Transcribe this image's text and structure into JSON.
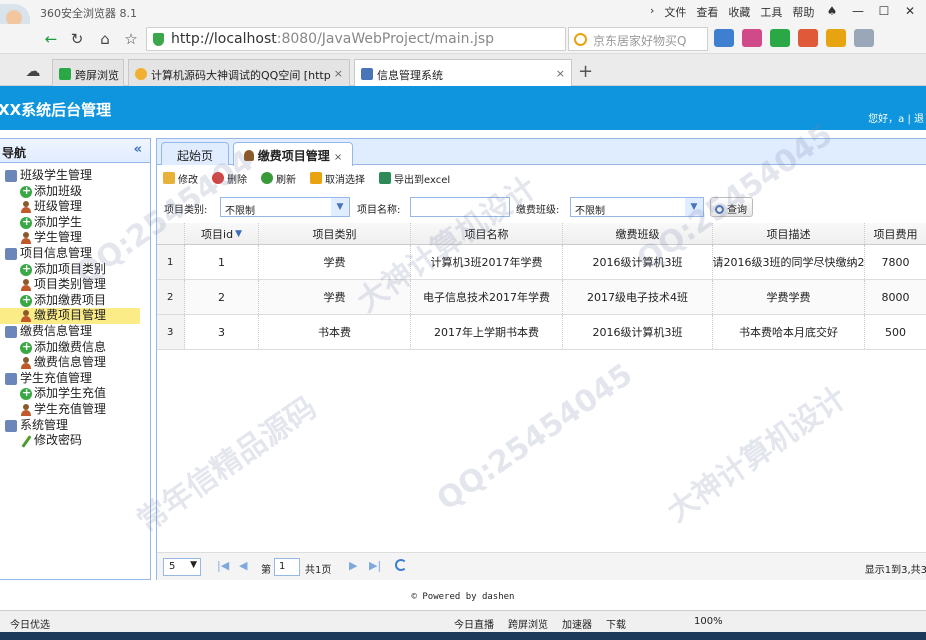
{
  "browser": {
    "app_title": "360安全浏览器 8.1",
    "menu": [
      "文件",
      "查看",
      "收藏",
      "工具",
      "帮助"
    ],
    "url_host": "http://localhost",
    "url_path": ":8080/JavaWebProject/main.jsp",
    "search_placeholder": "京东居家好物买Q",
    "tabs": [
      {
        "label": "跨屏浏览",
        "icon": "phone-icon",
        "color": "#2aa845"
      },
      {
        "label": "计算机源码大神调试的QQ空间 [http:",
        "icon": "star-icon",
        "color": "#f0b030"
      },
      {
        "label": "信息管理系统",
        "icon": "page-icon",
        "color": "#4a74b8"
      }
    ]
  },
  "app": {
    "title": "XX系统后台管理",
    "welcome": "您好，a | 退"
  },
  "sidebar": {
    "title": "导航",
    "collapse_glyph": "«",
    "groups": [
      {
        "label": "班级学生管理",
        "items": [
          {
            "label": "添加班级",
            "icon": "add-icon"
          },
          {
            "label": "班级管理",
            "icon": "user-icon"
          },
          {
            "label": "添加学生",
            "icon": "add-icon"
          },
          {
            "label": "学生管理",
            "icon": "user-icon"
          }
        ]
      },
      {
        "label": "项目信息管理",
        "items": [
          {
            "label": "添加项目类别",
            "icon": "add-icon"
          },
          {
            "label": "项目类别管理",
            "icon": "user-icon"
          },
          {
            "label": "添加缴费项目",
            "icon": "add-icon"
          },
          {
            "label": "缴费项目管理",
            "icon": "user-icon",
            "selected": true
          }
        ]
      },
      {
        "label": "缴费信息管理",
        "items": [
          {
            "label": "添加缴费信息",
            "icon": "add-icon"
          },
          {
            "label": "缴费信息管理",
            "icon": "user-icon"
          }
        ]
      },
      {
        "label": "学生充值管理",
        "items": [
          {
            "label": "添加学生充值",
            "icon": "add-icon"
          },
          {
            "label": "学生充值管理",
            "icon": "user-icon"
          }
        ]
      },
      {
        "label": "系统管理",
        "items": [
          {
            "label": "修改密码",
            "icon": "pencil-icon"
          }
        ]
      }
    ]
  },
  "main": {
    "tabs": [
      {
        "label": "起始页"
      },
      {
        "label": "缴费项目管理",
        "close": "×"
      }
    ],
    "toolbar": {
      "edit": "修改",
      "delete": "删除",
      "refresh": "刷新",
      "cancel_select": "取消选择",
      "export": "导出到excel"
    },
    "filter": {
      "type_label": "项目类别:",
      "type_value": "不限制",
      "name_label": "项目名称:",
      "name_value": "",
      "class_label": "缴费班级:",
      "class_value": "不限制",
      "query": "查询"
    },
    "grid": {
      "columns": [
        "项目id",
        "项目类别",
        "项目名称",
        "缴费班级",
        "项目描述",
        "项目费用"
      ],
      "rows": [
        {
          "rn": "1",
          "cells": [
            "1",
            "学费",
            "计算机3班2017年学费",
            "2016级计算机3班",
            "请2016级3班的同学尽快缴纳2",
            "7800"
          ]
        },
        {
          "rn": "2",
          "cells": [
            "2",
            "学费",
            "电子信息技术2017年学费",
            "2017级电子技术4班",
            "学费学费",
            "8000"
          ]
        },
        {
          "rn": "3",
          "cells": [
            "3",
            "书本费",
            "2017年上学期书本费",
            "2016级计算机3班",
            "书本费哈本月底交好",
            "500"
          ]
        }
      ]
    },
    "pager": {
      "page_size": "5",
      "page_label": "第",
      "page_value": "1",
      "total_pages": "共1页",
      "info": "显示1到3,共3"
    }
  },
  "footer": "© Powered by dashen",
  "statusbar": {
    "left": "今日优选",
    "items": [
      "今日直播",
      "跨屏浏览",
      "加速器",
      "下载",
      "100%"
    ]
  },
  "watermark": [
    "QQ:2545404",
    "大神计算机设计",
    "常年信精品源码",
    "QQ:25454045"
  ]
}
